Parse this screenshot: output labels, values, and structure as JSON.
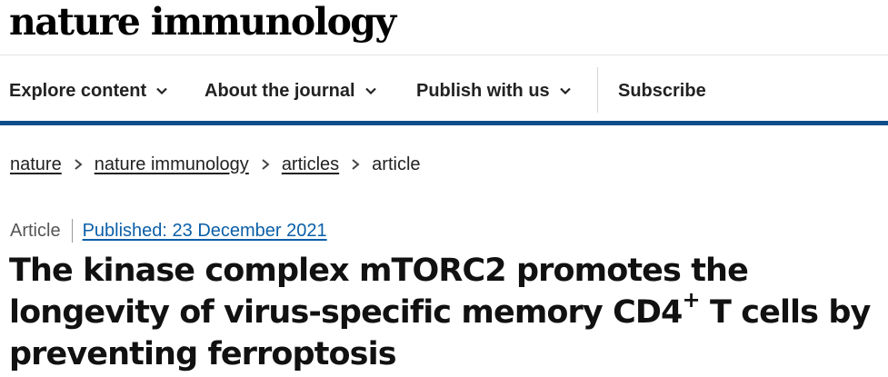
{
  "header": {
    "brand": "nature immunology"
  },
  "nav": {
    "items": [
      {
        "label": "Explore content",
        "has_dropdown": true
      },
      {
        "label": "About the journal",
        "has_dropdown": true
      },
      {
        "label": "Publish with us",
        "has_dropdown": true
      }
    ],
    "subscribe": "Subscribe"
  },
  "breadcrumb": {
    "items": [
      "nature",
      "nature immunology",
      "articles"
    ],
    "current": "article"
  },
  "article": {
    "type": "Article",
    "published": "Published: 23 December 2021",
    "title_part1": "The kinase complex mTORC2 promotes the longevity of virus-specific memory CD4",
    "title_sup": "+",
    "title_part2": " T cells by preventing ferroptosis"
  },
  "colors": {
    "accent_rule": "#0c4d8a",
    "link": "#0b5fa8"
  },
  "icons": {
    "dropdown": "chevron-down-icon",
    "breadcrumb_separator": "chevron-right-icon"
  }
}
